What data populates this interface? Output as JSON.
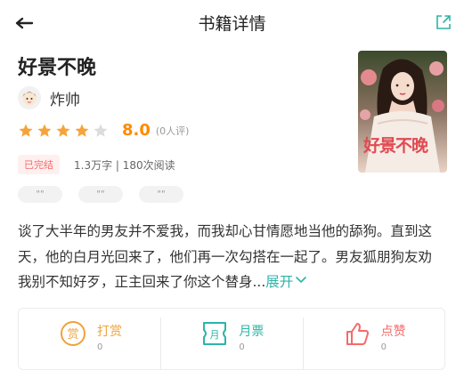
{
  "header": {
    "title": "书籍详情"
  },
  "book": {
    "title": "好景不晚",
    "author": "炸帅",
    "score": "8.0",
    "rating_count": "(0人评)",
    "stars": {
      "filled": 4,
      "total": 5
    },
    "status": "已完结",
    "stats": "1.3万字 | 180次阅读",
    "tags": [
      "\"\"",
      "\"\"",
      "\"\""
    ],
    "cover_title": "好景不晚",
    "description": "谈了大半年的男友并不爱我，而我却心甘情愿地当他的舔狗。直到这天，他的白月光回来了，他们再一次勾搭在一起了。男友狐朋狗友劝我别不知好歹，正主回来了你这个替身...",
    "expand_label": "展开"
  },
  "actions": [
    {
      "label": "打赏",
      "count": "0",
      "icon": "reward-icon",
      "color": "#f0a23a"
    },
    {
      "label": "月票",
      "count": "0",
      "icon": "ticket-icon",
      "color": "#2db4a7"
    },
    {
      "label": "点赞",
      "count": "0",
      "icon": "like-icon",
      "color": "#f46b6b"
    }
  ],
  "colors": {
    "accent": "#2db4a7",
    "score": "#ff8a00",
    "star": "#f7a33a",
    "status": "#f56a6a"
  }
}
